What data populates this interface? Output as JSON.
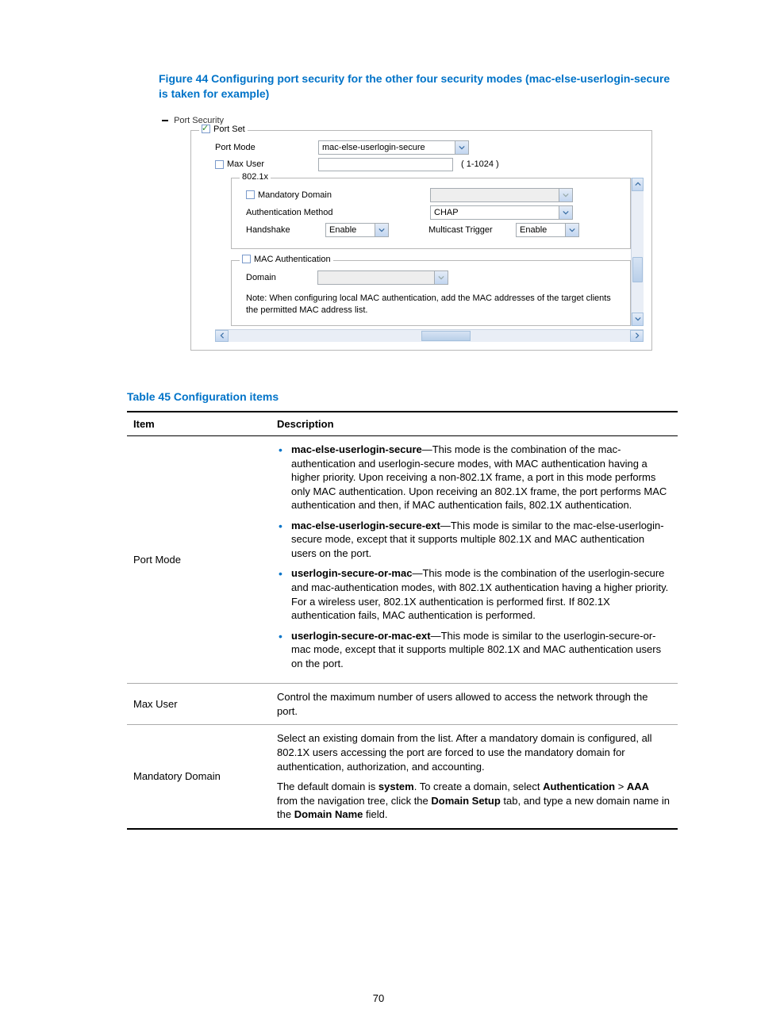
{
  "figure_caption": "Figure 44 Configuring port security for the other four security modes (mac-else-userlogin-secure is taken for example)",
  "screenshot": {
    "section_title": "Port Security",
    "portset_legend": "Port Set",
    "portset_checked": true,
    "port_mode_label": "Port Mode",
    "port_mode_value": "mac-else-userlogin-secure",
    "max_user_label": "Max User",
    "max_user_hint": "( 1-1024 )",
    "dot1x": {
      "legend": "802.1x",
      "mandatory_domain_label": "Mandatory Domain",
      "auth_method_label": "Authentication Method",
      "auth_method_value": "CHAP",
      "handshake_label": "Handshake",
      "handshake_value": "Enable",
      "multicast_trigger_label": "Multicast Trigger",
      "multicast_trigger_value": "Enable"
    },
    "mac_auth": {
      "legend": "MAC Authentication",
      "domain_label": "Domain",
      "note": "Note: When configuring local MAC authentication, add the MAC addresses of the target clients the permitted MAC address list."
    }
  },
  "table_caption": "Table 45 Configuration items",
  "table": {
    "head_item": "Item",
    "head_desc": "Description",
    "rows": {
      "port_mode": {
        "item": "Port Mode",
        "b1_bold": "mac-else-userlogin-secure",
        "b1_text": "—This mode is the combination of the mac-authentication and userlogin-secure modes, with MAC authentication having a higher priority. Upon receiving a non-802.1X frame, a port in this mode performs only MAC authentication. Upon receiving an 802.1X frame, the port performs MAC authentication and then, if MAC authentication fails, 802.1X authentication.",
        "b2_bold": "mac-else-userlogin-secure-ext",
        "b2_text": "—This mode is similar to the mac-else-userlogin-secure mode, except that it supports multiple 802.1X and MAC authentication users on the port.",
        "b3_bold": "userlogin-secure-or-mac",
        "b3_text": "—This mode is the combination of the userlogin-secure and mac-authentication modes, with 802.1X authentication having a higher priority. For a wireless user, 802.1X authentication is performed first. If 802.1X authentication fails, MAC authentication is performed.",
        "b4_bold": "userlogin-secure-or-mac-ext",
        "b4_text": "—This mode is similar to the userlogin-secure-or-mac mode, except that it supports multiple 802.1X and MAC authentication users on the port."
      },
      "max_user": {
        "item": "Max User",
        "desc": "Control the maximum number of users allowed to access the network through the port."
      },
      "mandatory_domain": {
        "item": "Mandatory Domain",
        "p1": "Select an existing domain from the list. After a mandatory domain is configured, all 802.1X users accessing the port are forced to use the mandatory domain for authentication, authorization, and accounting.",
        "p2_a": "The default domain is ",
        "p2_b1": "system",
        "p2_b": ". To create a domain, select ",
        "p2_b2": "Authentication",
        "p2_c": " > ",
        "p2_b3": "AAA",
        "p2_d": " from the navigation tree, click the ",
        "p2_b4": "Domain Setup",
        "p2_e": " tab, and type a new domain name in the ",
        "p2_b5": "Domain Name",
        "p2_f": " field."
      }
    }
  },
  "page_number": "70"
}
